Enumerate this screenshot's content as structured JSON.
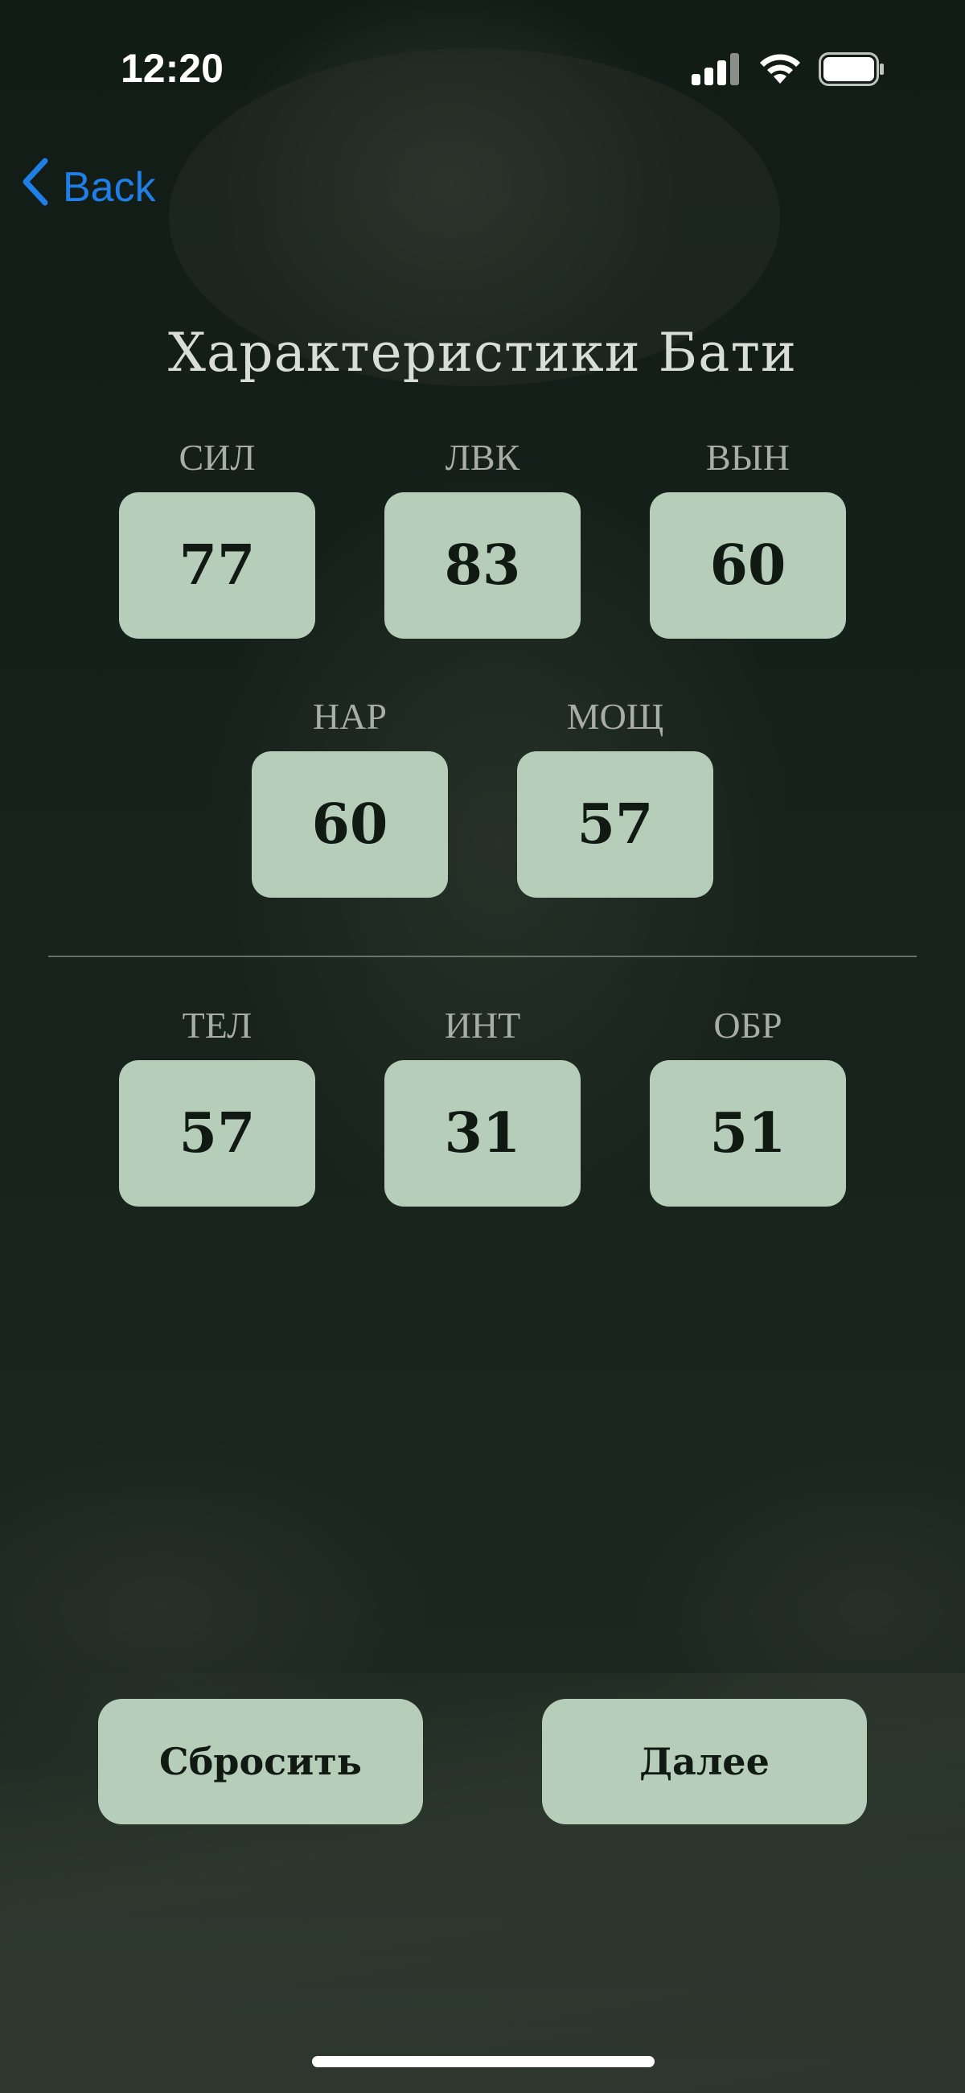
{
  "status_bar": {
    "time": "12:20",
    "icons": [
      "cellular-signal-icon",
      "wifi-icon",
      "battery-icon"
    ]
  },
  "nav": {
    "back_label": "Back",
    "back_icon": "chevron-left-icon",
    "accent_color": "#1f7fe6"
  },
  "title": "Характеристики Бати",
  "stats": {
    "sil": {
      "label": "СИЛ",
      "value": "77"
    },
    "lvk": {
      "label": "ЛВК",
      "value": "83"
    },
    "vyn": {
      "label": "ВЫН",
      "value": "60"
    },
    "nar": {
      "label": "НАР",
      "value": "60"
    },
    "moshch": {
      "label": "МОЩ",
      "value": "57"
    },
    "tel": {
      "label": "ТЕЛ",
      "value": "57"
    },
    "int": {
      "label": "ИНТ",
      "value": "31"
    },
    "obr": {
      "label": "ОБР",
      "value": "51"
    }
  },
  "buttons": {
    "reset_label": "Сбросить",
    "next_label": "Далее"
  },
  "colors": {
    "tile_background": "#b5cdb9",
    "tile_text": "#101a12",
    "screen_background": "#111c16"
  }
}
